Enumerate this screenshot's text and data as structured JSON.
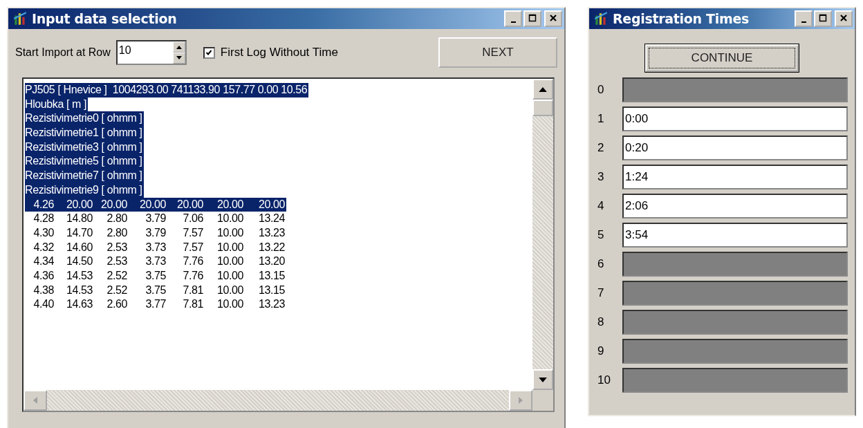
{
  "import_window": {
    "title": "Input data selection",
    "start_row": {
      "label": "Start Import at Row",
      "value": "10"
    },
    "first_log_checkbox": {
      "label": "First Log Without Time",
      "checked": true
    },
    "next_button": "NEXT",
    "lines": [
      {
        "kind": "text",
        "text": "PJ505 [ Hnevice ]  1004293.00 741133.90 157.77 0.00 10.56",
        "selected": true
      },
      {
        "kind": "text",
        "text": "Hloubka [ m ]",
        "selected": true
      },
      {
        "kind": "text",
        "text": "Rezistivimetrie0 [ ohmm ]",
        "selected": true
      },
      {
        "kind": "text",
        "text": "Rezistivimetrie1 [ ohmm ]",
        "selected": true
      },
      {
        "kind": "text",
        "text": "Rezistivimetrie3 [ ohmm ]",
        "selected": true
      },
      {
        "kind": "text",
        "text": "Rezistivimetrie5 [ ohmm ]",
        "selected": true
      },
      {
        "kind": "text",
        "text": "Rezistivimetrie7 [ ohmm ]",
        "selected": true
      },
      {
        "kind": "text",
        "text": "Rezistivimetrie9 [ ohmm ]",
        "selected": true
      },
      {
        "kind": "numbers",
        "cells": [
          "4.26",
          "20.00",
          "20.00",
          "20.00",
          "20.00",
          "20.00",
          "20.00"
        ],
        "selected": true
      },
      {
        "kind": "numbers",
        "cells": [
          "4.28",
          "14.80",
          "2.80",
          "3.79",
          "7.06",
          "10.00",
          "13.24"
        ],
        "selected": false
      },
      {
        "kind": "numbers",
        "cells": [
          "4.30",
          "14.70",
          "2.80",
          "3.79",
          "7.57",
          "10.00",
          "13.23"
        ],
        "selected": false
      },
      {
        "kind": "numbers",
        "cells": [
          "4.32",
          "14.60",
          "2.53",
          "3.73",
          "7.57",
          "10.00",
          "13.22"
        ],
        "selected": false
      },
      {
        "kind": "numbers",
        "cells": [
          "4.34",
          "14.50",
          "2.53",
          "3.73",
          "7.76",
          "10.00",
          "13.20"
        ],
        "selected": false
      },
      {
        "kind": "numbers",
        "cells": [
          "4.36",
          "14.53",
          "2.52",
          "3.75",
          "7.76",
          "10.00",
          "13.15"
        ],
        "selected": false
      },
      {
        "kind": "numbers",
        "cells": [
          "4.38",
          "14.53",
          "2.52",
          "3.75",
          "7.81",
          "10.00",
          "13.15"
        ],
        "selected": false
      },
      {
        "kind": "numbers",
        "cells": [
          "4.40",
          "14.63",
          "2.60",
          "3.77",
          "7.81",
          "10.00",
          "13.23"
        ],
        "selected": false
      }
    ]
  },
  "times_window": {
    "title": "Registration Times",
    "continue_button": "CONTINUE",
    "rows": [
      {
        "index": "0",
        "disabled": true
      },
      {
        "index": "1",
        "value": "0:00",
        "disabled": false
      },
      {
        "index": "2",
        "value": "0:20",
        "disabled": false
      },
      {
        "index": "3",
        "value": "1:24",
        "disabled": false
      },
      {
        "index": "4",
        "value": "2:06",
        "disabled": false
      },
      {
        "index": "5",
        "value": "3:54",
        "disabled": false
      },
      {
        "index": "6",
        "disabled": true
      },
      {
        "index": "7",
        "disabled": true
      },
      {
        "index": "8",
        "disabled": true
      },
      {
        "index": "9",
        "disabled": true
      },
      {
        "index": "10",
        "disabled": true
      }
    ]
  }
}
